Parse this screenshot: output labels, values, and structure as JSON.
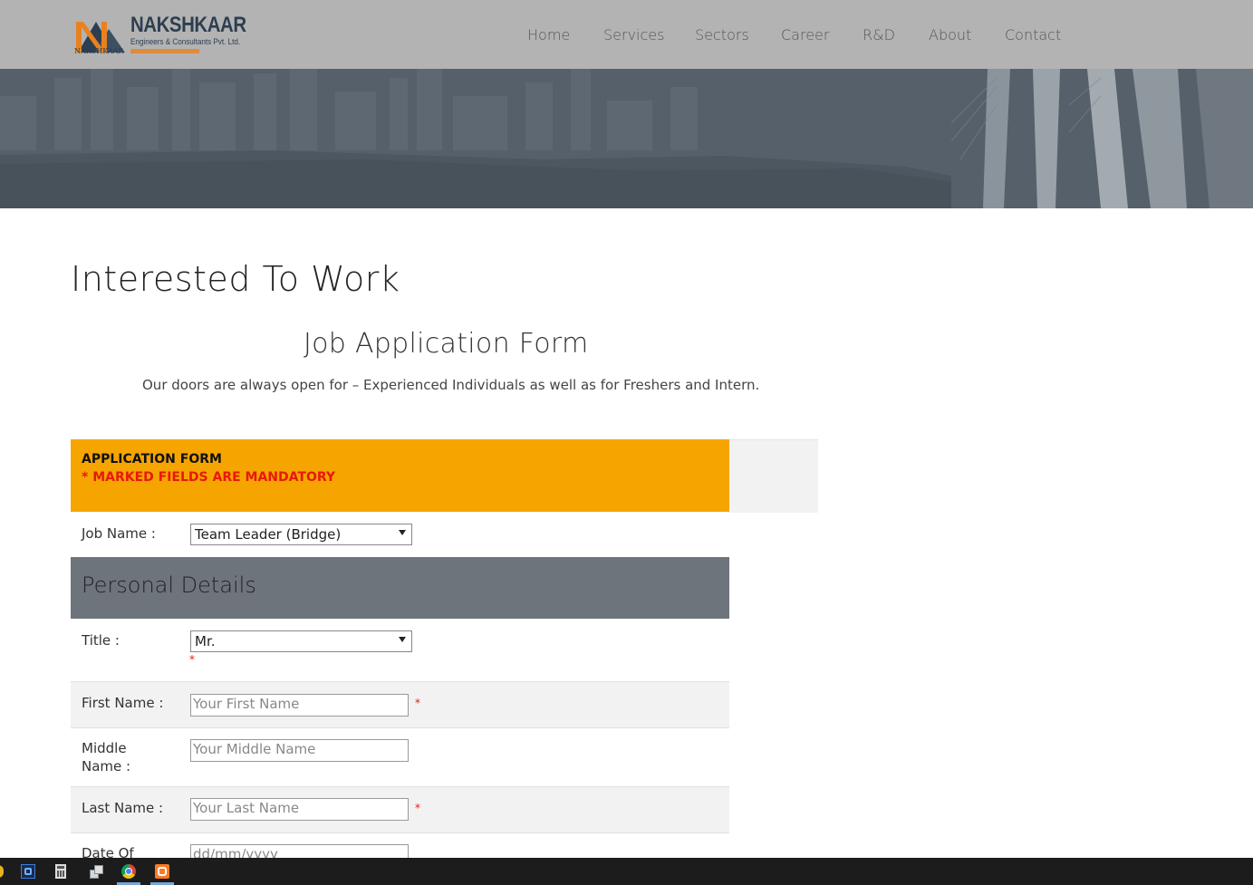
{
  "header": {
    "logo_title": "NAKSHKAAR",
    "logo_sub": "Engineers & Consultants Pvt. Ltd.",
    "logo_small": "NAKSHKAAR",
    "nav": [
      "Home",
      "Services",
      "Sectors",
      "Career",
      "R&D",
      "About",
      "Contact"
    ]
  },
  "main": {
    "heading": "Interested To Work",
    "form_title": "Job Application Form",
    "intro": "Our doors are always open for – Experienced Individuals as well as for Freshers and Intern."
  },
  "application_bar": {
    "title": "APPLICATION FORM",
    "mandatory_note": "* MARKED FIELDS ARE MANDATORY"
  },
  "form": {
    "job_name_label": "Job Name :",
    "job_name_value": "Team Leader (Bridge)",
    "section_title": "Personal Details",
    "title_label": "Title :",
    "title_value": "Mr.",
    "first_name_label": "First Name :",
    "first_name_placeholder": "Your First Name",
    "middle_name_label_1": "Middle",
    "middle_name_label_2": "Name :",
    "middle_name_placeholder": "Your Middle Name",
    "last_name_label": "Last Name :",
    "last_name_placeholder": "Your Last Name",
    "dob_label": "Date Of",
    "dob_placeholder": "dd/mm/yyyy",
    "required_marker": "*"
  },
  "colors": {
    "header_bg": "#b3b3b3",
    "accent_orange": "#f6a500",
    "required_red": "#e8180c",
    "section_bg": "#6e747c"
  },
  "taskbar": {
    "icons": [
      "eclipse-icon",
      "calculator-icon",
      "network-tool-icon",
      "chrome-icon",
      "xampp-icon"
    ]
  }
}
